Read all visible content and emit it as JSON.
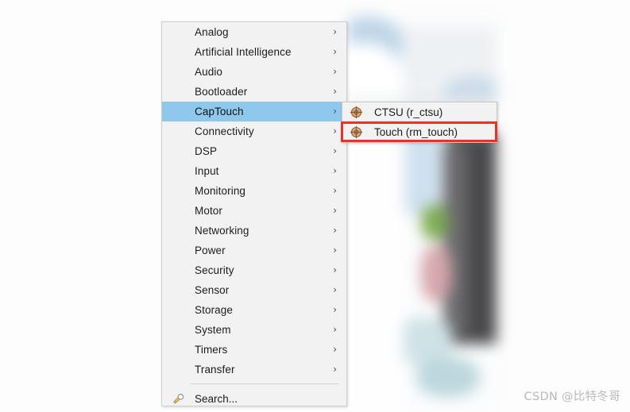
{
  "menu": {
    "items": [
      {
        "label": "Analog",
        "arrow": "›",
        "selected": false
      },
      {
        "label": "Artificial Intelligence",
        "arrow": "›",
        "selected": false
      },
      {
        "label": "Audio",
        "arrow": "›",
        "selected": false
      },
      {
        "label": "Bootloader",
        "arrow": "›",
        "selected": false
      },
      {
        "label": "CapTouch",
        "arrow": "›",
        "selected": true
      },
      {
        "label": "Connectivity",
        "arrow": "›",
        "selected": false
      },
      {
        "label": "DSP",
        "arrow": "›",
        "selected": false
      },
      {
        "label": "Input",
        "arrow": "›",
        "selected": false
      },
      {
        "label": "Monitoring",
        "arrow": "›",
        "selected": false
      },
      {
        "label": "Motor",
        "arrow": "›",
        "selected": false
      },
      {
        "label": "Networking",
        "arrow": "›",
        "selected": false
      },
      {
        "label": "Power",
        "arrow": "›",
        "selected": false
      },
      {
        "label": "Security",
        "arrow": "›",
        "selected": false
      },
      {
        "label": "Sensor",
        "arrow": "›",
        "selected": false
      },
      {
        "label": "Storage",
        "arrow": "›",
        "selected": false
      },
      {
        "label": "System",
        "arrow": "›",
        "selected": false
      },
      {
        "label": "Timers",
        "arrow": "›",
        "selected": false
      },
      {
        "label": "Transfer",
        "arrow": "›",
        "selected": false
      }
    ],
    "search": {
      "label": "Search...",
      "icon": "magnifier-icon"
    },
    "highlight_color": "#8ec8ec"
  },
  "submenu": {
    "parent": "CapTouch",
    "items": [
      {
        "label": "CTSU (r_ctsu)",
        "icon": "module-target-icon",
        "highlighted": false
      },
      {
        "label": "Touch (rm_touch)",
        "icon": "module-target-icon",
        "highlighted": true
      }
    ]
  },
  "annotation": {
    "type": "red-rectangle",
    "color": "#ee3124",
    "target": "Touch (rm_touch)"
  },
  "watermark": {
    "text": "CSDN @比特冬哥",
    "color": "#b9b9b9"
  }
}
